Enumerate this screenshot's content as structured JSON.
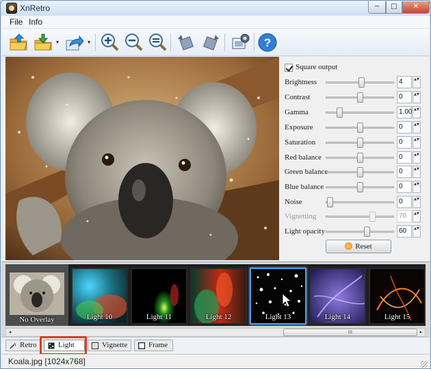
{
  "window": {
    "title": "XnRetro",
    "min": "−",
    "max": "□",
    "close": "✕"
  },
  "menu": [
    "File",
    "Info"
  ],
  "toolbar": {
    "dropdown_caret": "▾"
  },
  "panel": {
    "square_output": "Square output",
    "sliders": [
      {
        "label": "Brightness",
        "value": "4",
        "level": 0.52,
        "enabled": true
      },
      {
        "label": "Contrast",
        "value": "0",
        "level": 0.5,
        "enabled": true
      },
      {
        "label": "Gamma",
        "value": "1.00",
        "level": 0.2,
        "enabled": true
      },
      {
        "label": "Exposure",
        "value": "0",
        "level": 0.5,
        "enabled": true
      },
      {
        "label": "Saturation",
        "value": "0",
        "level": 0.5,
        "enabled": true
      },
      {
        "label": "Red balance",
        "value": "0",
        "level": 0.5,
        "enabled": true
      },
      {
        "label": "Green balance",
        "value": "0",
        "level": 0.5,
        "enabled": true
      },
      {
        "label": "Blue balance",
        "value": "0",
        "level": 0.5,
        "enabled": true
      },
      {
        "label": "Noise",
        "value": "0",
        "level": 0.06,
        "enabled": true
      },
      {
        "label": "Vignetting",
        "value": "70",
        "level": 0.68,
        "enabled": false
      },
      {
        "label": "Light opacity",
        "value": "60",
        "level": 0.6,
        "enabled": true
      }
    ],
    "spin_glyph": "▲▼",
    "reset": "Reset"
  },
  "thumbnails": [
    {
      "label": "No Overlay",
      "style": "none",
      "selected": false
    },
    {
      "label": "Light 10",
      "style": "l10",
      "selected": false
    },
    {
      "label": "Light 11",
      "style": "l11",
      "selected": false
    },
    {
      "label": "Light 12",
      "style": "l12",
      "selected": false
    },
    {
      "label": "Light 13",
      "style": "l13",
      "selected": true
    },
    {
      "label": "Light 14",
      "style": "l14",
      "selected": false
    },
    {
      "label": "Light 15",
      "style": "l15",
      "selected": false
    }
  ],
  "scrollbar": {
    "left": "◂",
    "right": "▸",
    "grip": "III"
  },
  "tabs": [
    {
      "label": "Retro",
      "active": false
    },
    {
      "label": "Light",
      "active": true
    },
    {
      "label": "Vignette",
      "active": false
    },
    {
      "label": "Frame",
      "active": false
    }
  ],
  "status": "Koala.jpg [1024x768]",
  "colors": {
    "accent": "#4d9de6",
    "highlight": "#e03a1e",
    "titlebar": "#cfdff1"
  }
}
